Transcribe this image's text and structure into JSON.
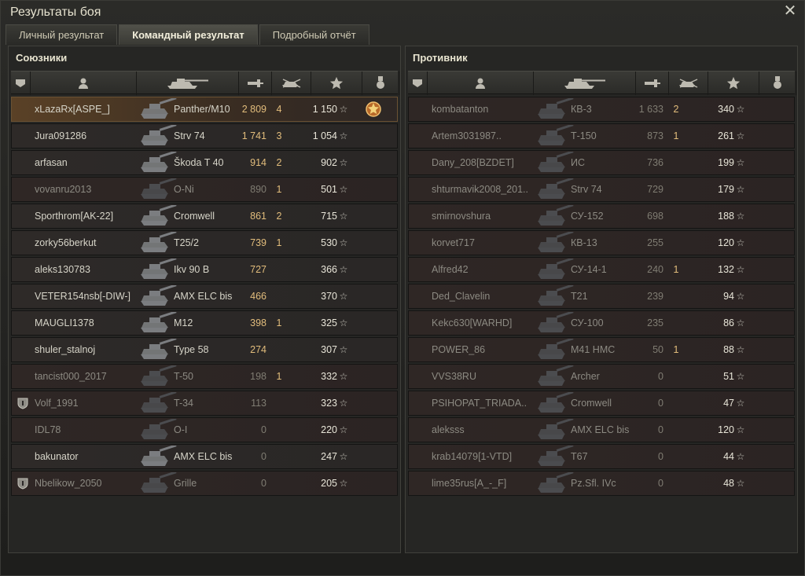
{
  "window": {
    "title": "Результаты боя",
    "close_icon": "close-icon"
  },
  "tabs": [
    {
      "label": "Личный результат",
      "active": false
    },
    {
      "label": "Командный результат",
      "active": true
    },
    {
      "label": "Подробный отчёт",
      "active": false
    }
  ],
  "colors": {
    "damage": "#e2bd7c",
    "top_row": "#5a4126",
    "dim": "#7f7c72"
  },
  "header_icons": [
    "squad-icon",
    "player-icon",
    "tank-icon",
    "damage-icon",
    "kills-icon",
    "xp-star-icon",
    "medal-icon"
  ],
  "allies": {
    "title": "Союзники",
    "rows": [
      {
        "name": "xLazaRx[ASPE_]",
        "tank": "Panther/M10",
        "damage": "2 809",
        "kills": "4",
        "xp": "1 150",
        "top": true,
        "dead": false,
        "medal": true,
        "squad": false
      },
      {
        "name": "Jura091286",
        "tank": "Strv 74",
        "damage": "1 741",
        "kills": "3",
        "xp": "1 054",
        "top": false,
        "dead": false,
        "medal": false,
        "squad": false
      },
      {
        "name": "arfasan",
        "tank": "Škoda T 40",
        "damage": "914",
        "kills": "2",
        "xp": "902",
        "top": false,
        "dead": false,
        "medal": false,
        "squad": false
      },
      {
        "name": "vovanru2013",
        "tank": "O-Ni",
        "damage": "890",
        "kills": "1",
        "xp": "501",
        "top": false,
        "dead": true,
        "medal": false,
        "squad": false
      },
      {
        "name": "Sporthrom[AK-22]",
        "tank": "Cromwell",
        "damage": "861",
        "kills": "2",
        "xp": "715",
        "top": false,
        "dead": false,
        "medal": false,
        "squad": false
      },
      {
        "name": "zorky56berkut",
        "tank": "T25/2",
        "damage": "739",
        "kills": "1",
        "xp": "530",
        "top": false,
        "dead": false,
        "medal": false,
        "squad": false
      },
      {
        "name": "aleks130783",
        "tank": "Ikv 90 B",
        "damage": "727",
        "kills": "",
        "xp": "366",
        "top": false,
        "dead": false,
        "medal": false,
        "squad": false
      },
      {
        "name": "VETER154nsb[-DIW-]",
        "tank": "AMX ELC bis",
        "damage": "466",
        "kills": "",
        "xp": "370",
        "top": false,
        "dead": false,
        "medal": false,
        "squad": false
      },
      {
        "name": "MAUGLI1378",
        "tank": "M12",
        "damage": "398",
        "kills": "1",
        "xp": "325",
        "top": false,
        "dead": false,
        "medal": false,
        "squad": false
      },
      {
        "name": "shuler_stalnoj",
        "tank": "Type 58",
        "damage": "274",
        "kills": "",
        "xp": "307",
        "top": false,
        "dead": false,
        "medal": false,
        "squad": false
      },
      {
        "name": "tancist000_2017",
        "tank": "T-50",
        "damage": "198",
        "kills": "1",
        "xp": "332",
        "top": false,
        "dead": true,
        "medal": false,
        "squad": false
      },
      {
        "name": "Volf_1991",
        "tank": "T-34",
        "damage": "113",
        "kills": "",
        "xp": "323",
        "top": false,
        "dead": true,
        "medal": false,
        "squad": true
      },
      {
        "name": "IDL78",
        "tank": "O-I",
        "damage": "0",
        "kills": "",
        "xp": "220",
        "top": false,
        "dead": true,
        "medal": false,
        "squad": false
      },
      {
        "name": "bakunator",
        "tank": "AMX ELC bis",
        "damage": "0",
        "kills": "",
        "xp": "247",
        "top": false,
        "dead": false,
        "medal": false,
        "squad": false
      },
      {
        "name": "Nbelikow_2050",
        "tank": "Grille",
        "damage": "0",
        "kills": "",
        "xp": "205",
        "top": false,
        "dead": true,
        "medal": false,
        "squad": true
      }
    ]
  },
  "enemies": {
    "title": "Противник",
    "rows": [
      {
        "name": "kombatanton",
        "tank": "КВ-3",
        "damage": "1 633",
        "kills": "2",
        "xp": "340",
        "dead": true
      },
      {
        "name": "Artem3031987..",
        "tank": "Т-150",
        "damage": "873",
        "kills": "1",
        "xp": "261",
        "dead": true
      },
      {
        "name": "Dany_208[BZDET]",
        "tank": "ИС",
        "damage": "736",
        "kills": "",
        "xp": "199",
        "dead": true
      },
      {
        "name": "shturmavik2008_201..",
        "tank": "Strv 74",
        "damage": "729",
        "kills": "",
        "xp": "179",
        "dead": true
      },
      {
        "name": "smirnovshura",
        "tank": "СУ-152",
        "damage": "698",
        "kills": "",
        "xp": "188",
        "dead": true
      },
      {
        "name": "korvet717",
        "tank": "КВ-13",
        "damage": "255",
        "kills": "",
        "xp": "120",
        "dead": true
      },
      {
        "name": "Alfred42",
        "tank": "СУ-14-1",
        "damage": "240",
        "kills": "1",
        "xp": "132",
        "dead": true
      },
      {
        "name": "Ded_Clavelin",
        "tank": "T21",
        "damage": "239",
        "kills": "",
        "xp": "94",
        "dead": true
      },
      {
        "name": "Kekc630[WARHD]",
        "tank": "СУ-100",
        "damage": "235",
        "kills": "",
        "xp": "86",
        "dead": true
      },
      {
        "name": "POWER_86",
        "tank": "M41 HMC",
        "damage": "50",
        "kills": "1",
        "xp": "88",
        "dead": true
      },
      {
        "name": "VVS38RU",
        "tank": "Archer",
        "damage": "0",
        "kills": "",
        "xp": "51",
        "dead": true
      },
      {
        "name": "PSIHOPAT_TRIADA..",
        "tank": "Cromwell",
        "damage": "0",
        "kills": "",
        "xp": "47",
        "dead": true
      },
      {
        "name": "aleksss",
        "tank": "AMX ELC bis",
        "damage": "0",
        "kills": "",
        "xp": "120",
        "dead": true
      },
      {
        "name": "krab14079[1-VTD]",
        "tank": "T67",
        "damage": "0",
        "kills": "",
        "xp": "44",
        "dead": true
      },
      {
        "name": "lime35rus[A_-_F]",
        "tank": "Pz.Sfl. IVc",
        "damage": "0",
        "kills": "",
        "xp": "48",
        "dead": true
      }
    ]
  },
  "star_glyph": "☆"
}
